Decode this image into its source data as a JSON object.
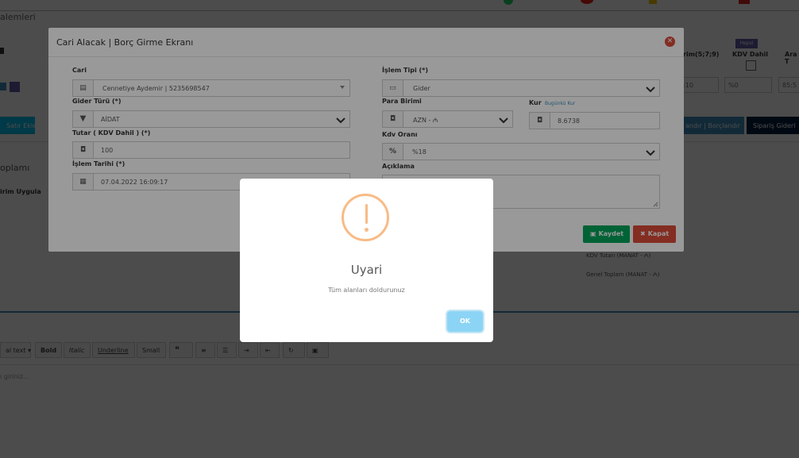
{
  "background": {
    "breadcrumb": "alemleri",
    "col_birim": "rim(5;7;9)",
    "col_kdv": "KDV Dahil",
    "col_ara": "Ara T",
    "badge_hepsi": "Hepsi",
    "field_price": "5:10",
    "field_kdv": "%0",
    "field_total": "85:5",
    "btn_satir_ekle": "Satır Ekle",
    "btn_alacak": "andır | Borçlandır",
    "btn_siparis": "Sipariş Giderl",
    "label_toplami": "oplamı",
    "label_uygula": "irim Uygula",
    "kdv_tutari": "KDV Tutarı (MANAT - ₼)",
    "genel_toplam": "Genel Toplam (MANAT - ₼)",
    "editor_toolbar": {
      "normal_text": "al text",
      "bold": "Bold",
      "italic": "Italic",
      "underline": "Underline",
      "small": "Small",
      "quote": "❝"
    },
    "editor_placeholder": "ı giriniz..."
  },
  "modal": {
    "title": "Cari Alacak | Borç Girme Ekranı",
    "cari_label": "Cari",
    "cari_value": "Cennetiye Aydemir | 5235698547",
    "gider_turu_label": "Gider Türü (*)",
    "gider_turu_value": "AİDAT",
    "tutar_label": "Tutar ( KDV Dahil ) (*)",
    "tutar_value": "100",
    "islem_tarihi_label": "İşlem Tarihi (*)",
    "islem_tarihi_value": "07.04.2022 16:09:17",
    "islem_tipi_label": "İşlem Tipi (*)",
    "islem_tipi_value": "Gider",
    "para_birimi_label": "Para Birimi",
    "para_birimi_value": "AZN - ₼",
    "kur_label": "Kur",
    "kur_link": "Bugünkü Kur",
    "kur_value": "8.6738",
    "kdv_orani_label": "Kdv Oranı",
    "kdv_orani_value": "%18",
    "aciklama_label": "Açıklama",
    "kaydet": "Kaydet",
    "kapat": "Kapat"
  },
  "alert": {
    "title": "Uyari",
    "text": "Tüm alanları doldurunuz",
    "ok": "OK"
  },
  "colors": {
    "primary": "#3c8dbc",
    "success": "#00a65a",
    "danger": "#dd4b39",
    "warning_icon": "#f8bb86",
    "ok_button": "#8cd4f5"
  }
}
